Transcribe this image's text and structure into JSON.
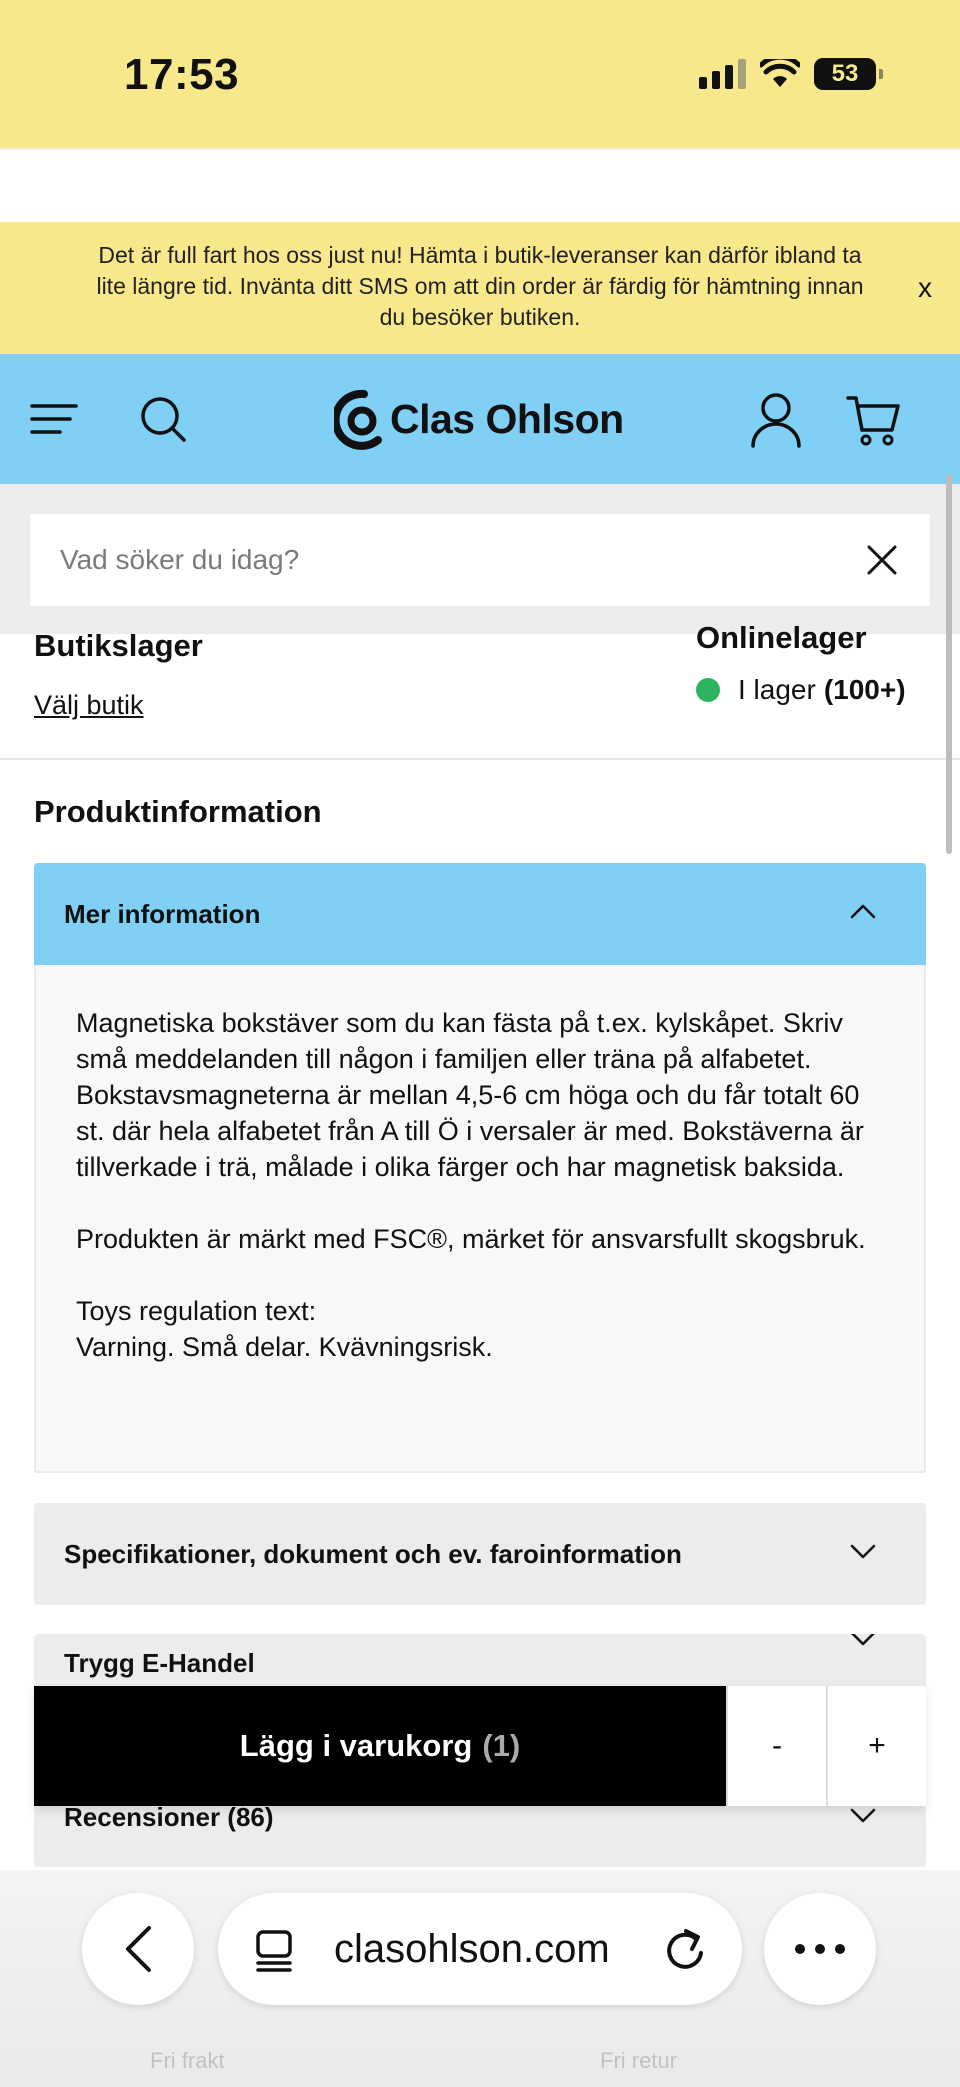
{
  "status_bar": {
    "time": "17:53",
    "battery": "53"
  },
  "banner": {
    "text": "Det är full fart hos oss just nu! Hämta i butik-leveranser kan därför ibland ta lite längre tid. Invänta ditt SMS om att din order är färdig för hämtning innan du besöker butiken.",
    "close_label": "x"
  },
  "header": {
    "logo_text": "Clas Ohlson"
  },
  "search": {
    "placeholder": "Vad söker du idag?"
  },
  "stock": {
    "store_title": "Butikslager",
    "choose_store": "Välj butik",
    "online_title": "Onlinelager",
    "online_status": "I lager",
    "online_count": "(100+)"
  },
  "product_info": {
    "title": "Produktinformation",
    "more_info": {
      "label": "Mer information",
      "paragraphs": [
        "Magnetiska bokstäver som du kan fästa på t.ex. kylskåpet. Skriv små meddelanden till någon i familjen eller träna på alfabetet. Bokstavsmagneterna är mellan 4,5-6 cm höga och du får totalt 60 st. där hela alfabetet från A till Ö i versaler är med. Bokstäverna är tillverkade i trä, målade i olika färger och har magnetisk baksida.",
        "Produkten är märkt med FSC®, märket för ansvarsfullt skogsbruk.",
        "Toys regulation text:\nVarning. Små delar. Kvävningsrisk."
      ]
    },
    "specs_label": "Specifikationer, dokument och ev. faroinformation",
    "trygg_label": "Trygg E-Handel",
    "reviews_label": "Recensioner (86)"
  },
  "cart": {
    "add_label": "Lägg i varukorg",
    "count": "(1)",
    "minus": "-",
    "plus": "+"
  },
  "browser": {
    "url": "clasohlson.com"
  },
  "ghost": {
    "left": "Fri frakt",
    "right": "Fri retur"
  },
  "colors": {
    "yellow": "#f8e88c",
    "blue": "#7fd0f4",
    "green": "#2db35d"
  }
}
